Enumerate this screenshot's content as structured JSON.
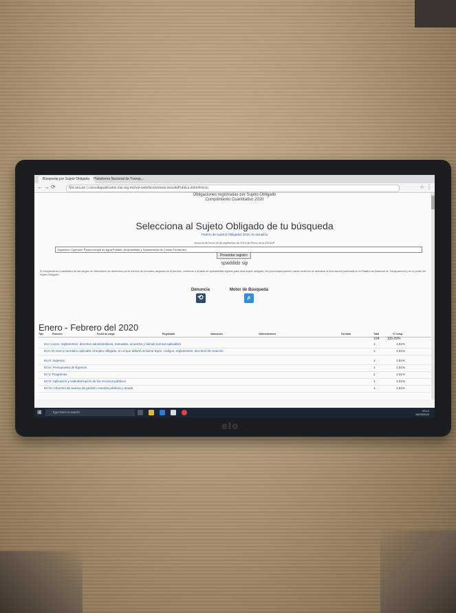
{
  "browser": {
    "tabs": [
      "Búsqueda por Sujeto Obligado",
      "Plataforma Nacional de Transp..."
    ],
    "url": "Not secure | consultapublicamx.inai.org.mx/vut-web/faces/view/consultaPublica.xhtml#inicio"
  },
  "header": {
    "subtitle_top": "Obligaciones registradas por Sujeto Obligado",
    "subtitle_year": "Cumplimiento Cuantitativo 2020",
    "title": "Selecciona al Sujeto Obligado de tu búsqueda",
    "padron_note": "Padrón de Sujetos Obligados 2018, se actualiza",
    "select_note": "Acuerdo de fecha 25 de septiembre de 2019 del Pleno de la CEGAIP",
    "selected_entity": "Organismo Operador Paramunicipal de Agua Potable, Alcantarillado y Saneamiento de Ciudad Fernández",
    "action_button": "Presentar registro",
    "sipot_label": "spaddidz sip"
  },
  "description": "El cumplimiento Cuantitativo de las cargas de información se determina por el número de formatos cargados en el periodo, conforme a la tabla de aplicabilidad vigente para cada sujeto obligado; los porcentajes pueden variar conforme se actualice la información publicada en la Plataforma Nacional de Transparencia y en el portal del Sujeto Obligado.",
  "tools": {
    "denuncia_label": "Denuncia",
    "motor_label": "Motor de Búsqueda"
  },
  "table": {
    "period": "Enero - Febrero del 2020",
    "headers": [
      "Tipo",
      "Fracción",
      "Fecha de carga",
      "Registrado",
      "Valoración",
      "Observaciones",
      "Formato",
      "Total",
      "% Cump."
    ],
    "total_count": "104",
    "total_percent": "105.09%",
    "rows": [
      {
        "text": "84 I: Leyes, reglamentos, decretos administrativos, manuales, acuerdos y demás normas aplicables",
        "count": "1",
        "percent": "1.01%"
      },
      {
        "text": "84 II: El marco normativo aplicable al sujeto obligado, en el que deberá incluirse leyes, códigos, reglamentos, decretos de creación",
        "count": "1",
        "percent": "1.01%"
      },
      {
        "text": "84 III: Ingresos",
        "count": "1",
        "percent": "1.01%"
      },
      {
        "text": "84 IV: Presupuesto de Egresos",
        "count": "1",
        "percent": "1.01%"
      },
      {
        "text": "84 V: Programas",
        "count": "1",
        "percent": "1.01%"
      },
      {
        "text": "84 VI: Aplicación y calendarización de los recursos públicos",
        "count": "1",
        "percent": "1.01%"
      },
      {
        "text": "84 VII: Informes de avance de gestión, cuentas públicas y deuda",
        "count": "1",
        "percent": "1.01%"
      }
    ]
  },
  "taskbar": {
    "search_placeholder": "Type here to search",
    "time": "09:12",
    "date": "18/03/2020"
  },
  "monitor_logo": "elo"
}
